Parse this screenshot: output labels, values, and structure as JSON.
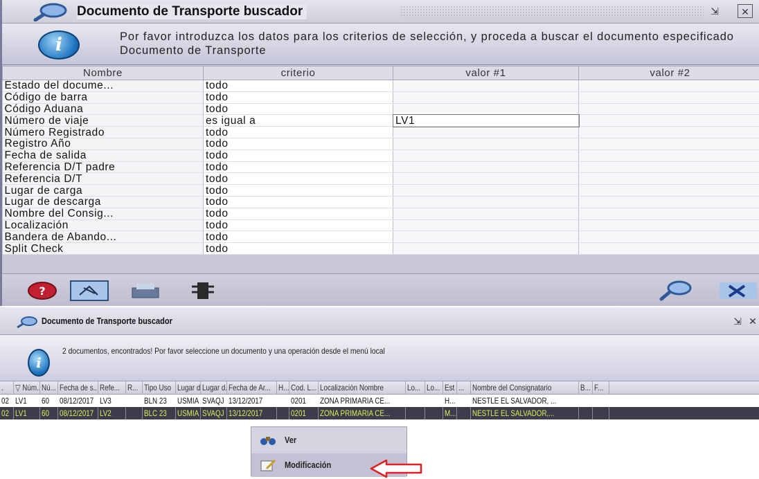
{
  "top_window": {
    "title": "Documento de Transporte buscador",
    "info_message": "Por favor introduzca los datos para los criterios de selección, y proceda a buscar el documento especificado Documento de Transporte",
    "columns": [
      "Nombre",
      "criterio",
      "valor #1",
      "valor #2"
    ],
    "rows": [
      {
        "name": "Estado del docume...",
        "criterio": "todo",
        "v1": "",
        "v2": ""
      },
      {
        "name": "Código de barra",
        "criterio": "todo",
        "v1": "",
        "v2": ""
      },
      {
        "name": "Código Aduana",
        "criterio": "todo",
        "v1": "",
        "v2": ""
      },
      {
        "name": "Número de viaje",
        "criterio": "es igual a",
        "v1": "LV1",
        "v2": ""
      },
      {
        "name": "Número Registrado",
        "criterio": "todo",
        "v1": "",
        "v2": ""
      },
      {
        "name": "Registro Año",
        "criterio": "todo",
        "v1": "",
        "v2": ""
      },
      {
        "name": "Fecha de salida",
        "criterio": "todo",
        "v1": "",
        "v2": ""
      },
      {
        "name": "Referencia D/T padre",
        "criterio": "todo",
        "v1": "",
        "v2": ""
      },
      {
        "name": "Referencia D/T",
        "criterio": "todo",
        "v1": "",
        "v2": ""
      },
      {
        "name": "Lugar de carga",
        "criterio": "todo",
        "v1": "",
        "v2": ""
      },
      {
        "name": "Lugar de descarga",
        "criterio": "todo",
        "v1": "",
        "v2": ""
      },
      {
        "name": "Nombre del Consig...",
        "criterio": "todo",
        "v1": "",
        "v2": ""
      },
      {
        "name": "Localización",
        "criterio": "todo",
        "v1": "",
        "v2": ""
      },
      {
        "name": "Bandera de Abando...",
        "criterio": "todo",
        "v1": "",
        "v2": ""
      },
      {
        "name": "Split Check",
        "criterio": "todo",
        "v1": "",
        "v2": ""
      }
    ],
    "toolbar_icons": [
      "help-icon",
      "clear-icon",
      "print-icon",
      "traffic-light-icon",
      "search-icon",
      "close-icon"
    ]
  },
  "bottom_window": {
    "title": "Documento de Transporte buscador",
    "info_message": "2 documentos, encontrados! Por favor seleccione un documento y una operación desde el menú local",
    "columns": [
      ".",
      "▽ Núm...",
      "Nú...",
      "Fecha de s...",
      "Refe...",
      "R...",
      "Tipo Uso",
      "Lugar d...",
      "Lugar d...",
      "Fecha de Ar...",
      "H...",
      "Cod. L...",
      "Localización Nombre",
      "Lo...",
      "Lo...",
      "Est",
      "...",
      "Nombre del Consignatario",
      "B...",
      "F..."
    ],
    "rows": [
      [
        "02",
        "LV1",
        "60",
        "08/12/2017",
        "LV3",
        "",
        "BLN 23",
        "USMIA",
        "SVAQJ",
        "13/12/2017",
        "",
        "0201",
        "ZONA PRIMARIA CE...",
        "",
        "",
        "H...",
        "",
        "NESTLE EL SALVADOR, ...",
        "",
        ""
      ],
      [
        "02",
        "LV1",
        "60",
        "08/12/2017",
        "LV2",
        "",
        "BLC 23",
        "USMIA",
        "SVAQJ",
        "13/12/2017",
        "",
        "0201",
        "ZONA PRIMARIA CE...",
        "",
        "",
        "M...",
        "",
        "NESTLE EL SALVADOR,...",
        "",
        ""
      ]
    ],
    "context_menu": [
      {
        "label": "Ver",
        "icon": "binoculars-icon"
      },
      {
        "label": "Modificación",
        "icon": "edit-icon"
      }
    ]
  }
}
